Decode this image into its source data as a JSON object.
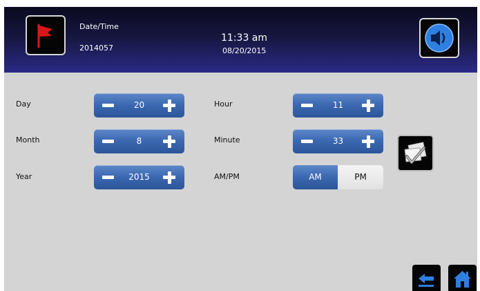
{
  "header": {
    "label": "Date/Time",
    "code": "2014057",
    "time": "11:33 am",
    "date": "08/20/2015"
  },
  "fields": {
    "day": {
      "label": "Day",
      "value": "20"
    },
    "month": {
      "label": "Month",
      "value": "8"
    },
    "year": {
      "label": "Year",
      "value": "2015"
    },
    "hour": {
      "label": "Hour",
      "value": "11"
    },
    "minute": {
      "label": "Minute",
      "value": "33"
    },
    "ampm": {
      "label": "AM/PM",
      "am": "AM",
      "pm": "PM",
      "selected": "AM"
    }
  },
  "icons": {
    "flag": "red-flag-icon",
    "sound": "speaker-icon",
    "confirm": "checklist-icon",
    "back": "back-arrow-icon",
    "home": "home-icon"
  },
  "colors": {
    "header_dark": "#0a0a20",
    "header_light": "#2a2a86",
    "stepper_blue": "#3a67b0",
    "background": "#d4d4d4",
    "flag_red": "#d81818",
    "icon_blue": "#2f7fe0"
  }
}
